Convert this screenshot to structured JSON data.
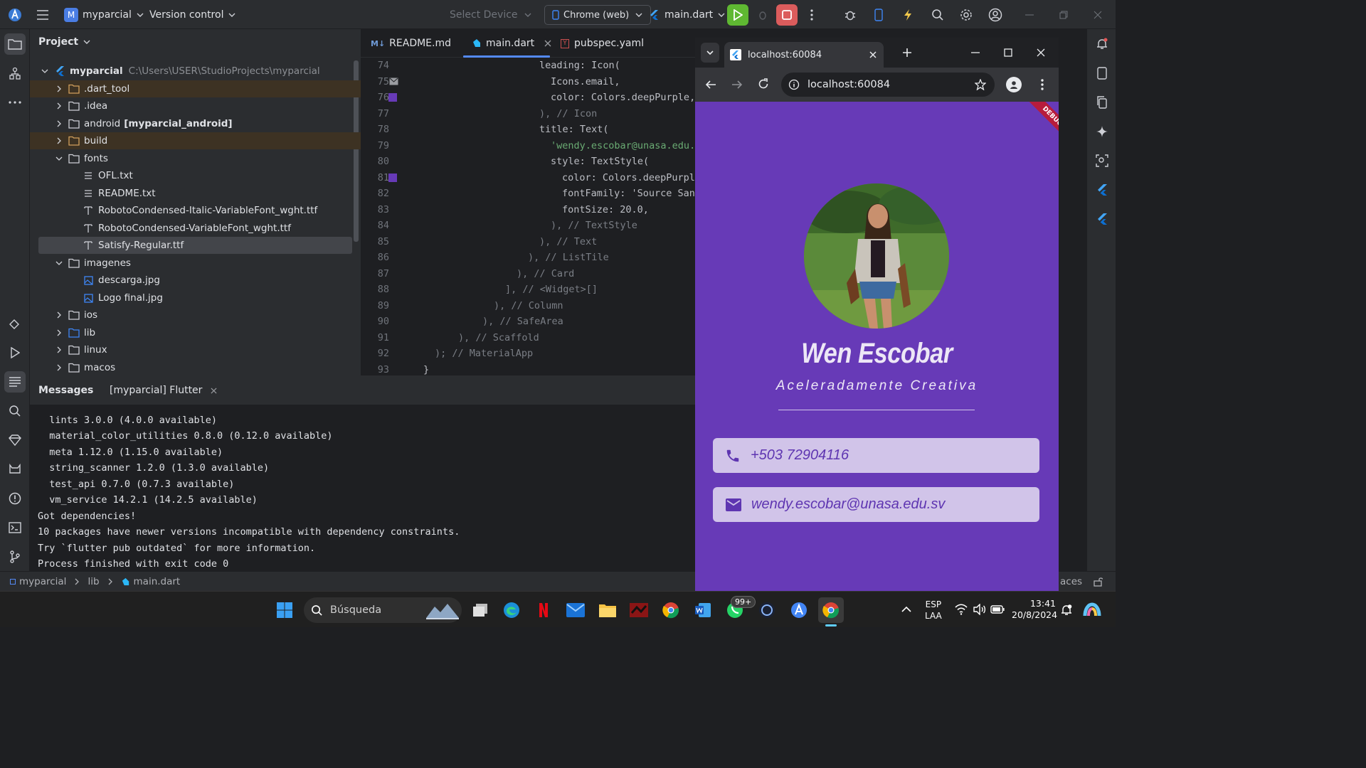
{
  "topbar": {
    "project_name": "myparcial",
    "project_badge": "M",
    "vcs": "Version control",
    "device_placeholder": "Select Device",
    "target": "Chrome (web)",
    "run_config": "main.dart"
  },
  "project_panel": {
    "title": "Project",
    "root": {
      "name": "myparcial",
      "path": "C:\\Users\\USER\\StudioProjects\\myparcial"
    },
    "items": [
      {
        "name": ".dart_tool"
      },
      {
        "name": ".idea"
      },
      {
        "name": "android",
        "suffix": "[myparcial_android]"
      },
      {
        "name": "build"
      },
      {
        "name": "fonts"
      },
      {
        "name": "OFL.txt"
      },
      {
        "name": "README.txt"
      },
      {
        "name": "RobotoCondensed-Italic-VariableFont_wght.ttf"
      },
      {
        "name": "RobotoCondensed-VariableFont_wght.ttf"
      },
      {
        "name": "Satisfy-Regular.ttf"
      },
      {
        "name": "imagenes"
      },
      {
        "name": "descarga.jpg"
      },
      {
        "name": "Logo final.jpg"
      },
      {
        "name": "ios"
      },
      {
        "name": "lib"
      },
      {
        "name": "linux"
      },
      {
        "name": "macos"
      }
    ]
  },
  "editor": {
    "tabs": [
      {
        "label": "README.md"
      },
      {
        "label": "main.dart"
      },
      {
        "label": "pubspec.yaml"
      }
    ],
    "lines": [
      {
        "n": "74",
        "text": "leading: Icon("
      },
      {
        "n": "75",
        "text": "Icons.email,"
      },
      {
        "n": "76",
        "text": "color: Colors.deepPurple,"
      },
      {
        "n": "77",
        "text": "), // Icon"
      },
      {
        "n": "78",
        "text": "title: Text("
      },
      {
        "n": "79",
        "text": "'wendy.escobar@unasa.edu."
      },
      {
        "n": "80",
        "text": "style: TextStyle("
      },
      {
        "n": "81",
        "text": "color: Colors.deepPurpl"
      },
      {
        "n": "82",
        "text": "fontFamily: 'Source San"
      },
      {
        "n": "83",
        "text": "fontSize: 20.0,"
      },
      {
        "n": "84",
        "text": "), // TextStyle"
      },
      {
        "n": "85",
        "text": "), // Text"
      },
      {
        "n": "86",
        "text": "), // ListTile"
      },
      {
        "n": "87",
        "text": "), // Card"
      },
      {
        "n": "88",
        "text": "], // <Widget>[]"
      },
      {
        "n": "89",
        "text": "), // Column"
      },
      {
        "n": "90",
        "text": "), // SafeArea"
      },
      {
        "n": "91",
        "text": "), // Scaffold"
      },
      {
        "n": "92",
        "text": "); // MaterialApp"
      },
      {
        "n": "93",
        "text": "}"
      }
    ]
  },
  "messages": {
    "title": "Messages",
    "tab": "[myparcial] Flutter",
    "lines": [
      "  lints 3.0.0 (4.0.0 available)",
      "  material_color_utilities 0.8.0 (0.12.0 available)",
      "  meta 1.12.0 (1.15.0 available)",
      "  string_scanner 1.2.0 (1.3.0 available)",
      "  test_api 0.7.0 (0.7.3 available)",
      "  vm_service 14.2.1 (14.2.5 available)",
      "Got dependencies!",
      "10 packages have newer versions incompatible with dependency constraints.",
      "Try `flutter pub outdated` for more information.",
      "Process finished with exit code 0"
    ]
  },
  "statusbar": {
    "crumbs": [
      "myparcial",
      "lib",
      "main.dart"
    ],
    "right_text": "aces"
  },
  "browser": {
    "tab_title": "localhost:60084",
    "url": "localhost:60084"
  },
  "app": {
    "debug_banner": "DEBUG",
    "name": "Wen Escobar",
    "subtitle": "Aceleradamente Creativa",
    "phone": "+503 72904116",
    "email": "wendy.escobar@unasa.edu.sv",
    "colors": {
      "background": "#673ab7",
      "card": "#d1c4e9",
      "text": "#5e35b1"
    }
  },
  "taskbar": {
    "search_placeholder": "Búsqueda",
    "whatsapp_badge": "99+",
    "lang_top": "ESP",
    "lang_bottom": "LAA",
    "time": "13:41",
    "date": "20/8/2024"
  }
}
